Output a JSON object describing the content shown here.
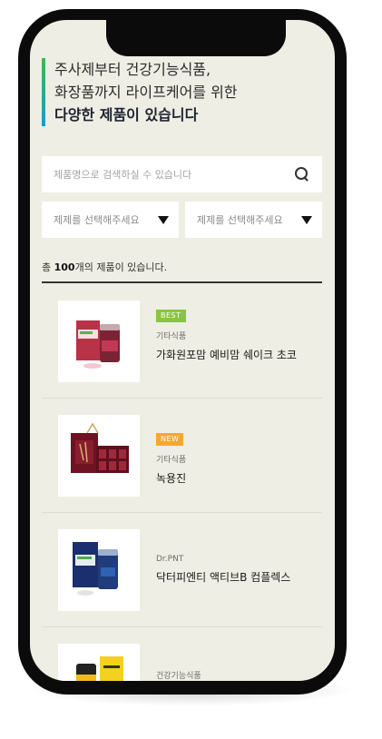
{
  "hero": {
    "line1": "주사제부터 건강기능식품,",
    "line2": "화장품까지 라이프케어를 위한",
    "line3": "다양한 제품이 있습니다"
  },
  "search": {
    "placeholder": "제품명으로 검색하실 수 있습니다",
    "icon": "search-icon"
  },
  "filters": [
    {
      "label": "제제를 선택해주세요",
      "icon": "caret-down-icon"
    },
    {
      "label": "제제를 선택해주세요",
      "icon": "caret-down-icon"
    }
  ],
  "summary": {
    "prefix": "총 ",
    "count": "100",
    "suffix": "개의 제품이 있습니다."
  },
  "products": [
    {
      "badge": "BEST",
      "category": "기타식품",
      "name": "가화원포맘 예비맘 쉐이크 초코"
    },
    {
      "badge": "NEW",
      "category": "기타식품",
      "name": "녹용진"
    },
    {
      "badge": "",
      "category": "Dr.PNT",
      "name": "닥터피엔티 액티브B 컴플렉스"
    },
    {
      "badge": "",
      "category": "건강기능식품",
      "name": ""
    }
  ],
  "colors": {
    "best": "#8ac53f",
    "new": "#f6a733",
    "background": "#eeeee4"
  }
}
